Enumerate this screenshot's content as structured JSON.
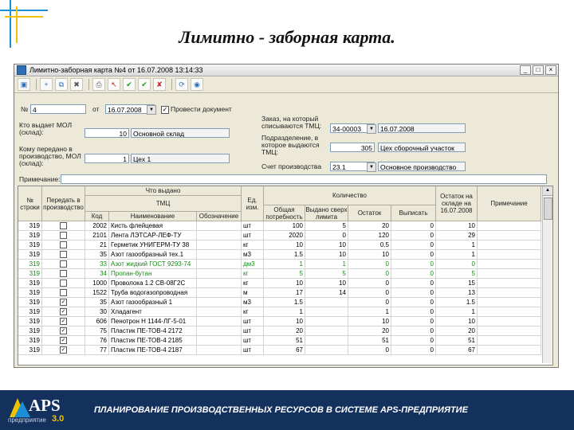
{
  "slide": {
    "title": "Лимитно - заборная карта.",
    "footer_text": "ПЛАНИРОВАНИЕ ПРОИЗВОДСТВЕННЫХ РЕСУРСОВ В СИСТЕМЕ APS-ПРЕДПРИЯТИЕ",
    "logo": {
      "name": "APS",
      "subtitle": "предприятие",
      "version": "3.0"
    },
    "accent_colors": {
      "blue": "#1a8fd6",
      "yellow": "#f2c200",
      "footer": "#14315e"
    }
  },
  "window": {
    "title": "Лимитно-заборная карта №4 от 16.07.2008 13:14:33",
    "buttons": {
      "minimize": "_",
      "maximize": "□",
      "close": "×"
    }
  },
  "toolbar": {
    "icons": [
      "save-icon",
      "new-icon",
      "copy-icon",
      "delete-icon",
      "print-icon",
      "pointer-icon",
      "check-green-icon",
      "check-green2-icon",
      "cancel-icon",
      "refresh-icon",
      "globe-icon"
    ],
    "glyphs": [
      "▣",
      "+",
      "⧉",
      "✖",
      "⎙",
      "↖",
      "✔",
      "✔",
      "✘",
      "⟳",
      "◉"
    ]
  },
  "form": {
    "number_label": "№",
    "number_value": "4",
    "date_label": "от",
    "date_value": "16.07.2008",
    "post_label": "Провести документ",
    "issuer_label": "Кто выдает МОЛ (склад):",
    "issuer_code": "10",
    "issuer_name": "Основной склад",
    "order_label": "Заказ, на который списываются ТМЦ:",
    "order_code": "34-00003",
    "order_date": "16.07.2008",
    "recipient_label": "Кому передано в производство, МОЛ (склад):",
    "recipient_code": "1",
    "recipient_name": "Цех 1",
    "dept_label": "Подразделение, в которое выдаются ТМЦ:",
    "dept_code": "305",
    "dept_name": "Цех сборочный участок",
    "account_label": "Счет производства",
    "account_code": "23.1",
    "account_name": "Основное производство",
    "note_label": "Примечание:",
    "note_value": ""
  },
  "grid": {
    "headers": {
      "num": "№ строки",
      "transfer": "Передать в производство",
      "issued_group": "Что выдано",
      "tmc": "ТМЦ",
      "code": "Код",
      "name": "Наименование",
      "designation": "Обозначение",
      "unit": "Ед. изм.",
      "qty_group": "Количество",
      "total_need": "Общая потребность",
      "over_limit": "Выдано сверх лимита",
      "remaining": "Остаток",
      "issue": "Выписать",
      "stock": "Остаток на складе на 16.07.2008",
      "note": "Примечание"
    },
    "rows": [
      {
        "num": "319",
        "checked": false,
        "code": "2002",
        "name": "Кисть флейцевая",
        "desig": "",
        "unit": "шт",
        "need": "100",
        "over": "5",
        "rem": "20",
        "issue": "0",
        "stock": "10",
        "green": false
      },
      {
        "num": "319",
        "checked": false,
        "code": "2101",
        "name": "Лента ЛЭТСАР-ЛЕФ-ТУ",
        "desig": "",
        "unit": "шт",
        "need": "2020",
        "over": "0",
        "rem": "120",
        "issue": "0",
        "stock": "29",
        "green": false
      },
      {
        "num": "319",
        "checked": false,
        "code": "21",
        "name": "Герметик УНИГЕРМ-ТУ 38",
        "desig": "",
        "unit": "кг",
        "need": "10",
        "over": "10",
        "rem": "0.5",
        "issue": "0",
        "stock": "1",
        "green": false
      },
      {
        "num": "319",
        "checked": false,
        "code": "35",
        "name": "Азот газообразный тех.1",
        "desig": "",
        "unit": "м3",
        "need": "1.5",
        "over": "10",
        "rem": "10",
        "issue": "0",
        "stock": "1",
        "green": false
      },
      {
        "num": "319",
        "checked": false,
        "code": "33",
        "name": "Азот жидкий ГОСТ 9293-74",
        "desig": "",
        "unit": "дм3",
        "need": "1",
        "over": "1",
        "rem": "0",
        "issue": "0",
        "stock": "0",
        "green": true
      },
      {
        "num": "319",
        "checked": false,
        "code": "34",
        "name": "Пропан-бутан",
        "desig": "",
        "unit": "кг",
        "need": "5",
        "over": "5",
        "rem": "0",
        "issue": "0",
        "stock": "5",
        "green": true
      },
      {
        "num": "319",
        "checked": false,
        "code": "1000",
        "name": "Проволока 1.2 СВ-08Г2С",
        "desig": "",
        "unit": "кг",
        "need": "10",
        "over": "10",
        "rem": "0",
        "issue": "0",
        "stock": "15",
        "green": false
      },
      {
        "num": "319",
        "checked": false,
        "code": "1522",
        "name": "Труба водогазопроводная",
        "desig": "",
        "unit": "м",
        "need": "17",
        "over": "14",
        "rem": "0",
        "issue": "0",
        "stock": "13",
        "green": false
      },
      {
        "num": "319",
        "checked": true,
        "code": "35",
        "name": "Азот газообразный 1",
        "desig": "",
        "unit": "м3",
        "need": "1.5",
        "over": "",
        "rem": "0",
        "issue": "0",
        "stock": "1.5",
        "green": false
      },
      {
        "num": "319",
        "checked": true,
        "code": "30",
        "name": "Хладагент",
        "desig": "",
        "unit": "кг",
        "need": "1",
        "over": "",
        "rem": "1",
        "issue": "0",
        "stock": "1",
        "green": false
      },
      {
        "num": "319",
        "checked": true,
        "code": "606",
        "name": "Пенотрон Н 1144-ЛГ-5-01",
        "desig": "",
        "unit": "шт",
        "need": "10",
        "over": "",
        "rem": "10",
        "issue": "0",
        "stock": "10",
        "green": false
      },
      {
        "num": "319",
        "checked": true,
        "code": "75",
        "name": "Пластик ПЕ-ТОВ-4 2172",
        "desig": "",
        "unit": "шт",
        "need": "20",
        "over": "",
        "rem": "20",
        "issue": "0",
        "stock": "20",
        "green": false
      },
      {
        "num": "319",
        "checked": true,
        "code": "76",
        "name": "Пластик ПЕ-ТОВ-4 2185",
        "desig": "",
        "unit": "шт",
        "need": "51",
        "over": "",
        "rem": "51",
        "issue": "0",
        "stock": "51",
        "green": false
      },
      {
        "num": "319",
        "checked": true,
        "code": "77",
        "name": "Пластик ПЕ-ТОВ-4 2187",
        "desig": "",
        "unit": "шт",
        "need": "67",
        "over": "",
        "rem": "0",
        "issue": "0",
        "stock": "67",
        "green": false
      }
    ]
  }
}
